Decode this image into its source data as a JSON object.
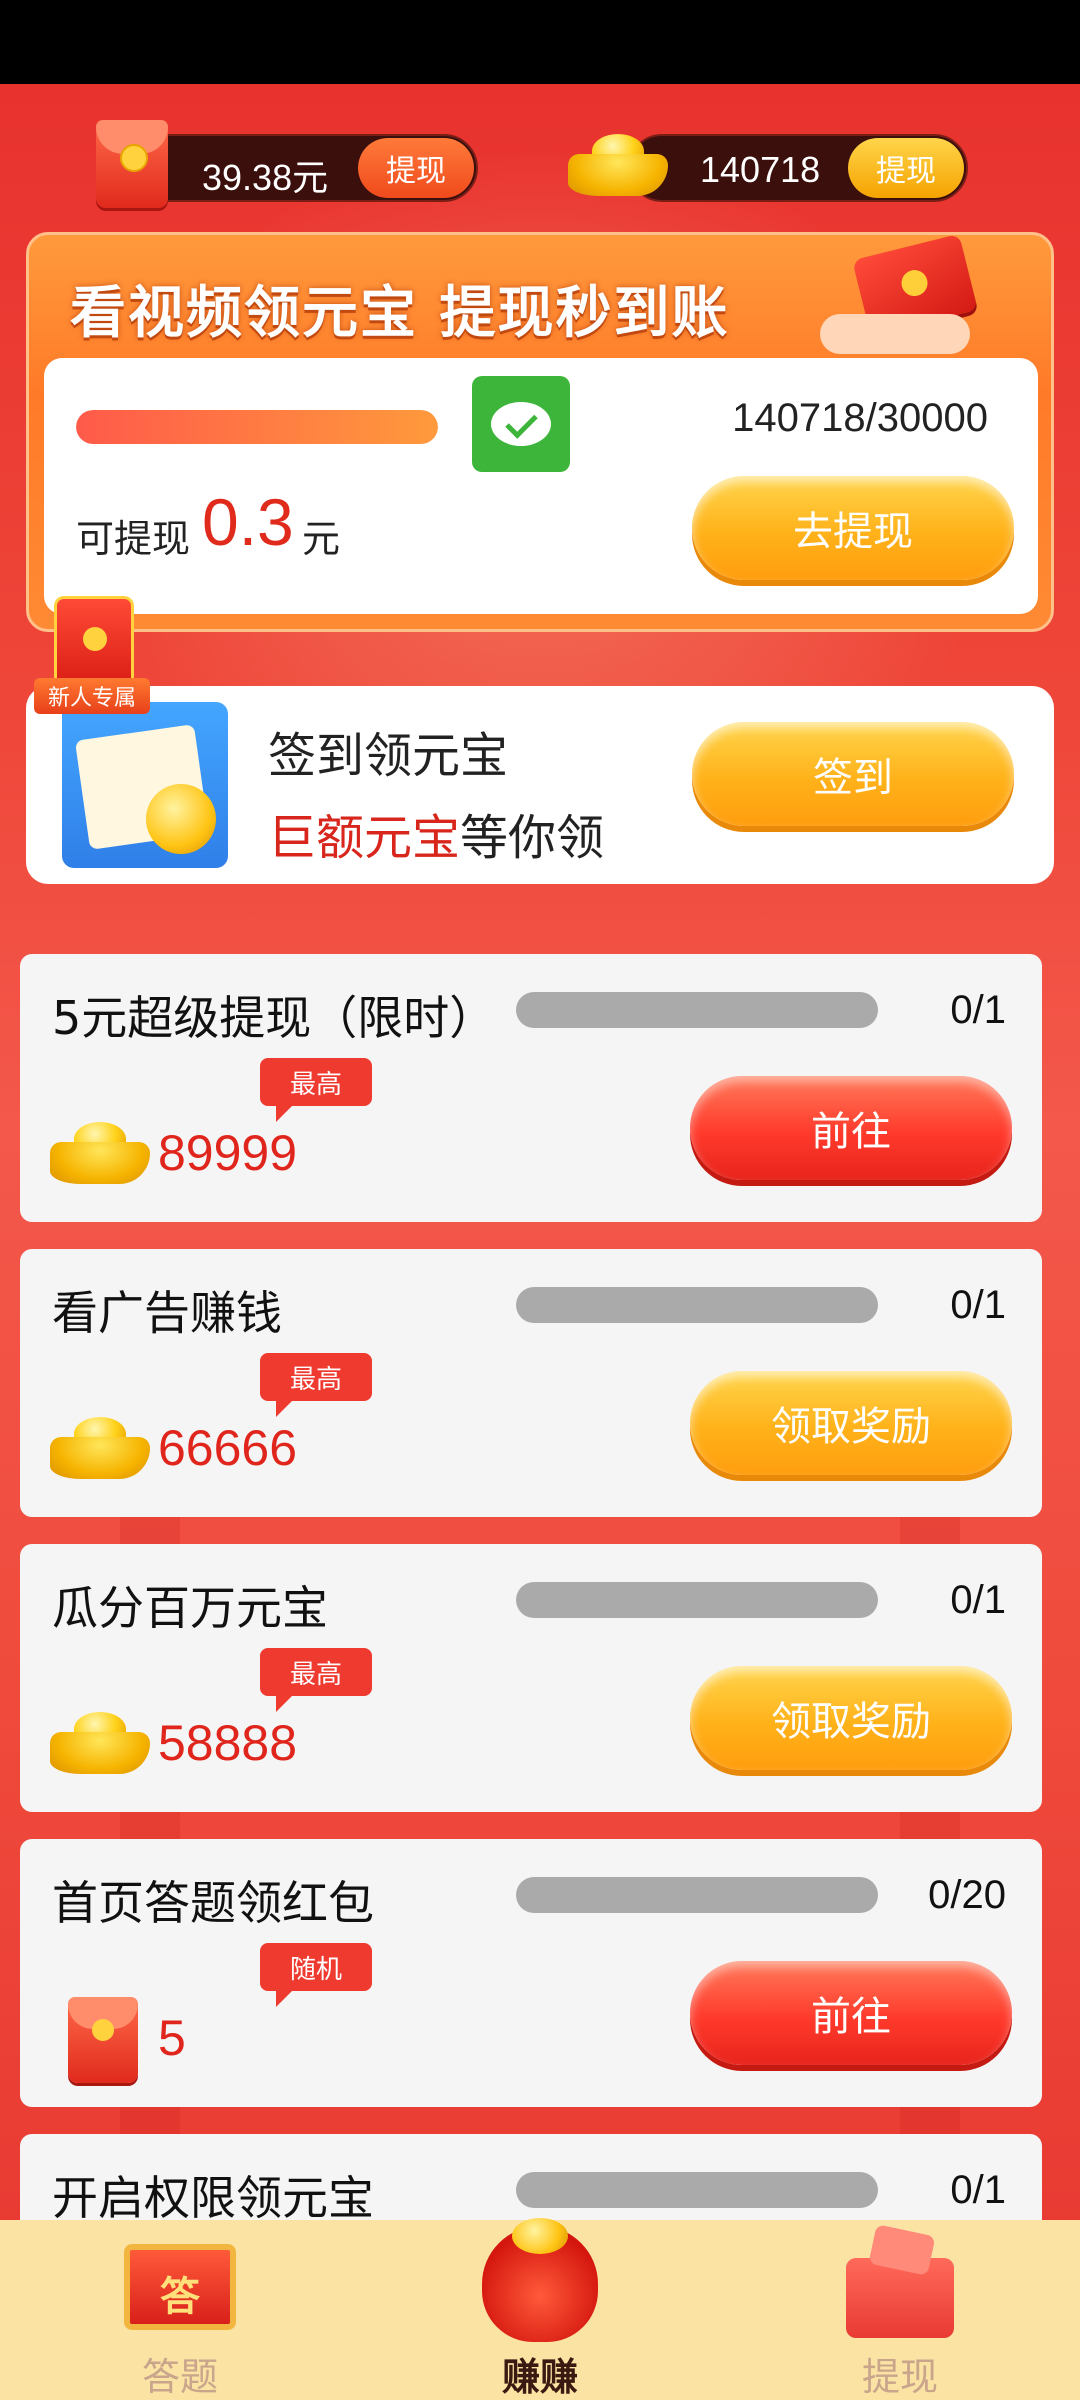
{
  "balances": {
    "cash_amount": "39.38元",
    "cash_button": "提现",
    "coin_amount": "140718",
    "coin_button": "提现"
  },
  "banner": {
    "title": "看视频领元宝 提现秒到账",
    "progress_fraction": 1.0,
    "progress_text": "140718/30000",
    "withdraw_prefix": "可提现",
    "withdraw_value": "0.3",
    "withdraw_unit": "元",
    "withdraw_button": "去提现"
  },
  "signin": {
    "badge": "新人专属",
    "title": "签到领元宝",
    "subtitle_highlight": "巨额元宝",
    "subtitle_rest": "等你领",
    "button": "签到"
  },
  "tasks": [
    {
      "title": "5元超级提现（限时）",
      "progress": 0,
      "count": "0/1",
      "tag": "最高",
      "reward": "89999",
      "reward_icon": "ingot-icon",
      "button": "前往",
      "button_style": "red"
    },
    {
      "title": "看广告赚钱",
      "progress": 0,
      "count": "0/1",
      "tag": "最高",
      "reward": "66666",
      "reward_icon": "ingot-icon",
      "button": "领取奖励",
      "button_style": "yellow"
    },
    {
      "title": "瓜分百万元宝",
      "progress": 0,
      "count": "0/1",
      "tag": "最高",
      "reward": "58888",
      "reward_icon": "ingot-icon",
      "button": "领取奖励",
      "button_style": "yellow"
    },
    {
      "title": "首页答题领红包",
      "progress": 0,
      "count": "0/20",
      "tag": "随机",
      "reward": "5",
      "reward_icon": "red-packet-icon",
      "button": "前往",
      "button_style": "red"
    },
    {
      "title": "开启权限领元宝",
      "progress": 0,
      "count": "0/1"
    }
  ],
  "nav": {
    "items": [
      {
        "label": "答题",
        "icon": "answer-scroll-icon",
        "icon_text": "答",
        "active": false
      },
      {
        "label": "赚赚",
        "icon": "lucky-bag-icon",
        "active": true
      },
      {
        "label": "提现",
        "icon": "gift-box-icon",
        "active": false
      }
    ]
  },
  "colors": {
    "background": "#ee4538",
    "accent_red": "#e0261c",
    "button_yellow": "#ffb21a",
    "button_red": "#ff3a2c",
    "nav_background": "#fbe3a4"
  }
}
